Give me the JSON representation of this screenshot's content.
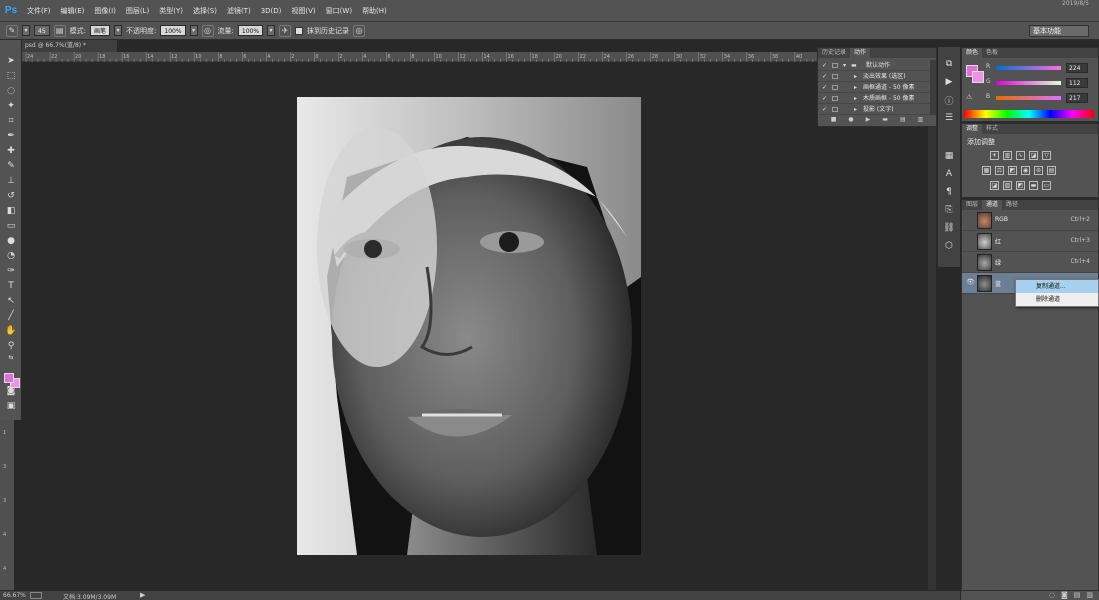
{
  "app": {
    "logo": "Ps",
    "clock": "2019/8/5"
  },
  "menu": [
    "文件(F)",
    "编辑(E)",
    "图像(I)",
    "图层(L)",
    "类型(Y)",
    "选择(S)",
    "滤镜(T)",
    "3D(D)",
    "视图(V)",
    "窗口(W)",
    "帮助(H)"
  ],
  "options": {
    "brush_size": "45",
    "mode_label": "模式:",
    "mode_value": "画笔",
    "opacity_label": "不透明度:",
    "opacity_value": "100%",
    "flow_label": "流量:",
    "flow_value": "100%",
    "erase_history": "抹到历史记录",
    "workspace": "基本功能"
  },
  "document": {
    "tab": "psd @ 66.7%(蓝/8) *",
    "zoom": "66.67%",
    "doc_info": "文档:3.09M/3.09M"
  },
  "ruler": {
    "top": [
      "24",
      "22",
      "20",
      "18",
      "16",
      "14",
      "12",
      "10",
      "8",
      "6",
      "4",
      "2",
      "0",
      "2",
      "4",
      "6",
      "8",
      "10",
      "12",
      "14",
      "16",
      "18",
      "20",
      "22",
      "24",
      "26",
      "28",
      "30",
      "32",
      "34",
      "36",
      "38",
      "40",
      "42",
      "44",
      "46",
      "48",
      "50"
    ]
  },
  "history_panel": {
    "tabs": [
      "历史记录",
      "动作"
    ],
    "active_tab": 1,
    "rows": [
      {
        "label": "默认动作",
        "folder": true
      },
      {
        "label": "淡出效果 (选区)"
      },
      {
        "label": "画框通道 - 50 像素"
      },
      {
        "label": "木质画框 - 50 像素"
      },
      {
        "label": "投影 (文字)"
      }
    ]
  },
  "color_panel": {
    "tabs": [
      "颜色",
      "色板"
    ],
    "fg_color": "#e070d8",
    "bg_color": "#f090e8",
    "channels": [
      {
        "label": "R",
        "value": "224"
      },
      {
        "label": "G",
        "value": "112"
      },
      {
        "label": "B",
        "value": "217"
      }
    ]
  },
  "adjustments_panel": {
    "tabs": [
      "调整",
      "样式"
    ],
    "title": "添加调整"
  },
  "channels_panel": {
    "tabs": [
      "图层",
      "通道",
      "路径"
    ],
    "active_tab": 1,
    "rows": [
      {
        "name": "RGB",
        "shortcut": "Ctrl+2",
        "visible": false
      },
      {
        "name": "红",
        "shortcut": "Ctrl+3",
        "visible": false
      },
      {
        "name": "绿",
        "shortcut": "Ctrl+4",
        "visible": false
      },
      {
        "name": "蓝",
        "shortcut": "",
        "visible": true
      }
    ],
    "context_menu": [
      "复制通道...",
      "删除通道"
    ]
  },
  "colors": {
    "accent": "#31a8ff",
    "chrome": "#535353",
    "canvas": "#282828",
    "highlight": "#a6d0ee"
  }
}
